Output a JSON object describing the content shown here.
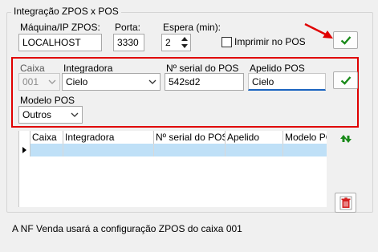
{
  "group": {
    "title": "Integração ZPOS x POS"
  },
  "top": {
    "machine_label": "Máquina/IP ZPOS:",
    "machine_value": "LOCALHOST",
    "port_label": "Porta:",
    "port_value": "3330",
    "wait_label": "Espera (min):",
    "wait_value": "2",
    "print_label": "Imprimir no POS",
    "print_checked": false
  },
  "form": {
    "caixa_label": "Caixa",
    "caixa_value": "001",
    "integradora_label": "Integradora",
    "integradora_value": "Cielo",
    "serial_label": "Nº serial do POS",
    "serial_value": "542sd2",
    "apelido_label": "Apelido POS",
    "apelido_value": "Cielo",
    "modelo_label": "Modelo POS",
    "modelo_value": "Outros"
  },
  "grid": {
    "columns": [
      "Caixa",
      "Integradora",
      "Nº serial do POS",
      "Apelido",
      "Modelo PC"
    ],
    "rows": [
      [
        "",
        "",
        "",
        "",
        ""
      ]
    ]
  },
  "footer": {
    "text": "A NF Venda usará a configuração ZPOS do caixa 001"
  },
  "colors": {
    "accent_check": "#1a8a1a",
    "highlight_red": "#e00000",
    "selection": "#bfe0f7",
    "delete_red": "#d42020"
  },
  "icons": [
    "check-icon",
    "chevron-down-icon",
    "spin-arrows-icon",
    "sort-arrows-icon",
    "trash-icon",
    "red-arrow"
  ]
}
